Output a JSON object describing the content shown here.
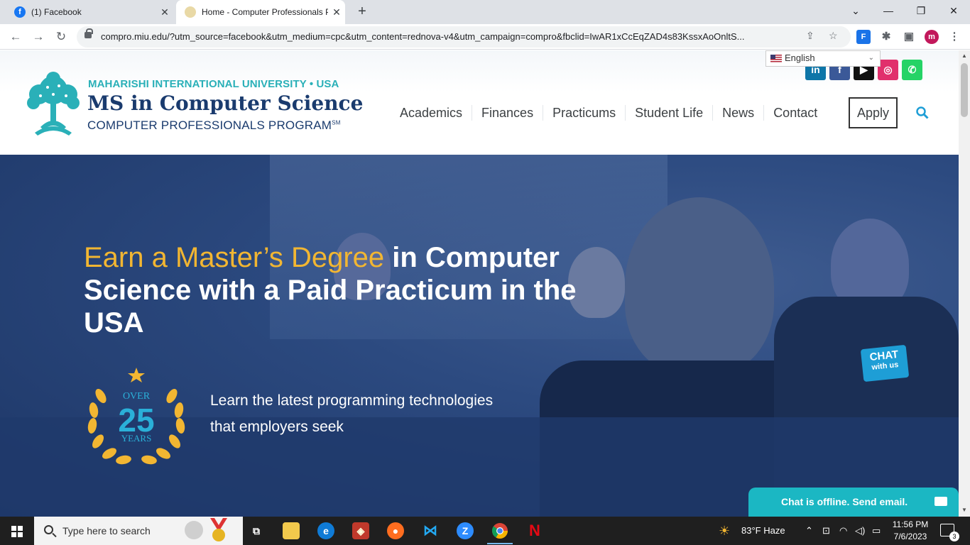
{
  "browser": {
    "tabs": [
      {
        "title": "(1) Facebook",
        "favicon": "f"
      },
      {
        "title": "Home - Computer Professionals P",
        "favicon": ""
      }
    ],
    "url": "compro.miu.edu/?utm_source=facebook&utm_medium=cpc&utm_content=rednova-v4&utm_campaign=compro&fbclid=IwAR1xCcEqZAD4s83KssxAoOnltS...",
    "profile_initial": "m",
    "extension_label": "F"
  },
  "site": {
    "university": "MAHARISHI INTERNATIONAL UNIVERSITY • USA",
    "program_title": "MS in Computer Science",
    "program_subtitle": "COMPUTER PROFESSIONALS PROGRAM",
    "program_mark": "SM",
    "language": "English",
    "social": [
      {
        "name": "linkedin",
        "glyph": "in",
        "color": "#0e76a8"
      },
      {
        "name": "facebook",
        "glyph": "f",
        "color": "#3b5998"
      },
      {
        "name": "youtube",
        "glyph": "▶",
        "color": "#111111"
      },
      {
        "name": "instagram",
        "glyph": "◎",
        "color": "#e1306c"
      },
      {
        "name": "whatsapp",
        "glyph": "✆",
        "color": "#25d366"
      }
    ],
    "nav": [
      "Academics",
      "Finances",
      "Practicums",
      "Student Life",
      "News",
      "Contact"
    ],
    "apply_label": "Apply"
  },
  "hero": {
    "title_highlight": "Earn a Master’s Degree",
    "title_rest": " in Computer Science with a Paid Practicum in the USA",
    "badge_over": "OVER",
    "badge_number": "25",
    "badge_years": "YEARS",
    "subtitle": "Learn the latest programming technologies that employers seek"
  },
  "chat": {
    "badge_line1": "CHAT",
    "badge_line2": "with us",
    "offline_text": "Chat is offline. Send email."
  },
  "taskbar": {
    "search_placeholder": "Type here to search",
    "weather": "83°F  Haze",
    "time": "11:56 PM",
    "date": "7/6/2023",
    "notification_count": "3"
  },
  "colors": {
    "brand_teal": "#2ab0b8",
    "brand_navy": "#1a3b6e",
    "hero_gold": "#f2b632",
    "chat_teal": "#1bb7c3"
  }
}
